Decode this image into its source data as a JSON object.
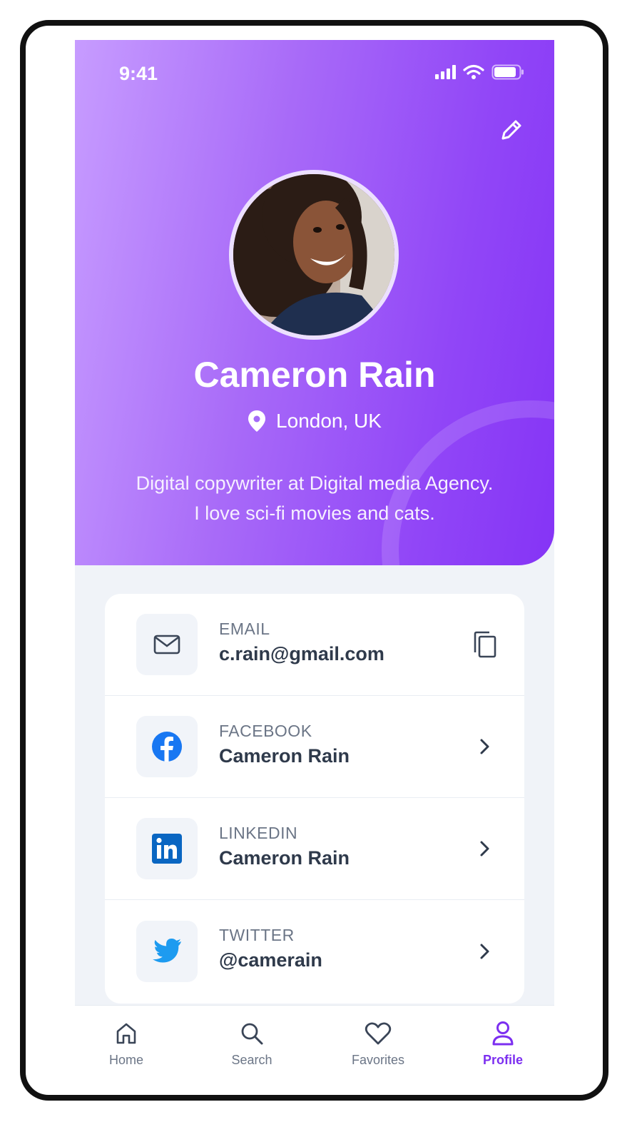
{
  "status_bar": {
    "time": "9:41"
  },
  "profile": {
    "name": "Cameron Rain",
    "location": "London, UK",
    "bio_line1": "Digital copywriter at Digital media Agency.",
    "bio_line2": "I love sci-fi movies and cats."
  },
  "contacts": [
    {
      "label": "EMAIL",
      "value": "c.rain@gmail.com",
      "icon": "mail-icon",
      "action": "copy-icon"
    },
    {
      "label": "FACEBOOK",
      "value": "Cameron Rain",
      "icon": "facebook-icon",
      "action": "chevron-right-icon"
    },
    {
      "label": "LINKEDIN",
      "value": "Cameron Rain",
      "icon": "linkedin-icon",
      "action": "chevron-right-icon"
    },
    {
      "label": "TWITTER",
      "value": "@camerain",
      "icon": "twitter-icon",
      "action": "chevron-right-icon"
    }
  ],
  "tabbar": {
    "items": [
      {
        "label": "Home",
        "icon": "home-icon",
        "active": false
      },
      {
        "label": "Search",
        "icon": "search-icon",
        "active": false
      },
      {
        "label": "Favorites",
        "icon": "heart-icon",
        "active": false
      },
      {
        "label": "Profile",
        "icon": "user-icon",
        "active": true
      }
    ]
  },
  "colors": {
    "accent": "#7c2ff0",
    "hero_start": "#c79cff",
    "hero_end": "#8534f6",
    "facebook": "#1877f2",
    "linkedin": "#0a66c2",
    "twitter": "#1d9bf0"
  }
}
